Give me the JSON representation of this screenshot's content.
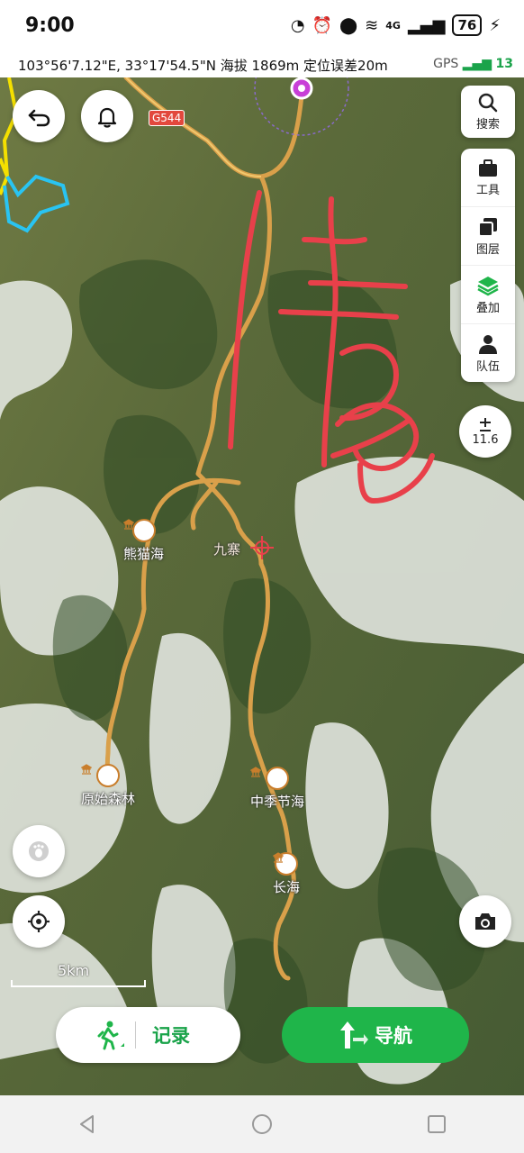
{
  "status_bar": {
    "time": "9:00",
    "network": "4G",
    "battery": "76"
  },
  "coordinates": {
    "text": "103°56'7.12\"E, 33°17'54.5\"N  海拔 1869m  定位误差20m",
    "gps_label": "GPS",
    "gps_count": "13"
  },
  "map": {
    "road_badge": "G544",
    "place_labels": [
      "熊猫海",
      "九寨",
      "原始森林",
      "中季节海",
      "长海"
    ],
    "scale_label": "5km",
    "zoom_level": "11.6",
    "track_color": "#d9a04a",
    "annotation_color": "#e8404a"
  },
  "toolbar": {
    "search_label": "搜索",
    "tools_label": "工具",
    "layers_label": "图层",
    "overlay_label": "叠加",
    "team_label": "队伍"
  },
  "bottom": {
    "record_label": "记录",
    "nav_label": "导航"
  }
}
